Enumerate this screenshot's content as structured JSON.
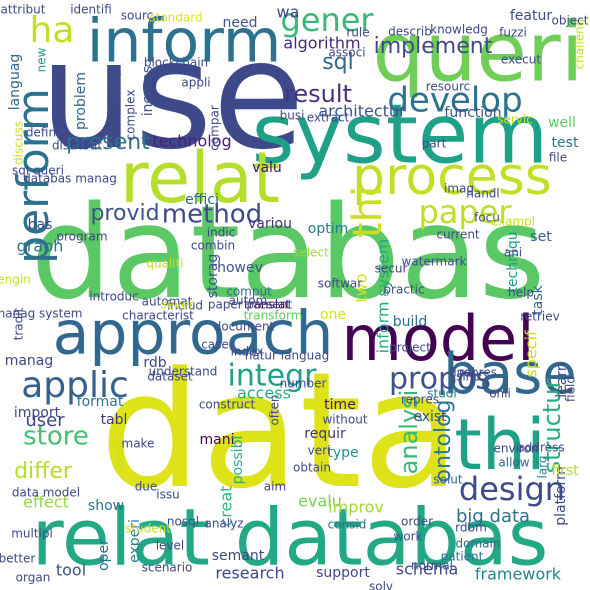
{
  "words": [
    {
      "text": "databas",
      "color": "#5ac864"
    },
    {
      "text": "data",
      "color": "#dde318"
    },
    {
      "text": "use",
      "color": "#3e4989"
    },
    {
      "text": "relat databas",
      "color": "#22a884"
    },
    {
      "text": "system",
      "color": "#1fa188"
    },
    {
      "text": "queri",
      "color": "#6ece58"
    },
    {
      "text": "inform",
      "color": "#2c728e"
    },
    {
      "text": "model",
      "color": "#440154"
    },
    {
      "text": "approach",
      "color": "#31688e"
    },
    {
      "text": "process",
      "color": "#c2df23"
    },
    {
      "text": "relat",
      "color": "#b5de2b"
    },
    {
      "text": "base",
      "color": "#31688e"
    },
    {
      "text": "thi",
      "color": "#1fa188"
    },
    {
      "text": "thi",
      "color": "#c8e020"
    },
    {
      "text": "develop",
      "color": "#2c728e"
    },
    {
      "text": "gener",
      "color": "#38b977"
    },
    {
      "text": "paper",
      "color": "#bddf26"
    },
    {
      "text": "design",
      "color": "#3e4a89"
    },
    {
      "text": "perform",
      "color": "#2c728e"
    },
    {
      "text": "ha",
      "color": "#c2df23"
    },
    {
      "text": "applic",
      "color": "#35608d"
    },
    {
      "text": "implement",
      "color": "#3f4788"
    },
    {
      "text": "propos",
      "color": "#3b528b"
    },
    {
      "text": "integr",
      "color": "#1fa188"
    },
    {
      "text": "method",
      "color": "#3e4989"
    },
    {
      "text": "store",
      "color": "#46c06f"
    },
    {
      "text": "analysi",
      "color": "#38b977"
    },
    {
      "text": "ontolog",
      "color": "#2a788e"
    },
    {
      "text": "structur",
      "color": "#27ad81"
    },
    {
      "text": "result",
      "color": "#46307e"
    },
    {
      "text": "sql",
      "color": "#31688e"
    },
    {
      "text": "differ",
      "color": "#b5de2b"
    },
    {
      "text": "provid",
      "color": "#3b528b"
    },
    {
      "text": "present",
      "color": "#2c728e"
    },
    {
      "text": "architectur",
      "color": "#3b528b"
    },
    {
      "text": "technolog",
      "color": "#482173"
    },
    {
      "text": "algorithm",
      "color": "#482878"
    },
    {
      "text": "user",
      "color": "#3e4989"
    },
    {
      "text": "big data",
      "color": "#2c728e"
    },
    {
      "text": "research",
      "color": "#3e4989"
    },
    {
      "text": "framework",
      "color": "#26828e"
    },
    {
      "text": "semant",
      "color": "#3f4788"
    },
    {
      "text": "tool",
      "color": "#3b528b"
    },
    {
      "text": "schema",
      "color": "#3f4788"
    },
    {
      "text": "support",
      "color": "#3e4989"
    },
    {
      "text": "evalu",
      "color": "#75d054"
    },
    {
      "text": "improv",
      "color": "#a0da39"
    },
    {
      "text": "type",
      "color": "#21918c"
    },
    {
      "text": "requir",
      "color": "#46327e"
    },
    {
      "text": "time",
      "color": "#48186a"
    },
    {
      "text": "exist",
      "color": "#3e4989"
    },
    {
      "text": "studi",
      "color": "#287c8e"
    },
    {
      "text": "specif",
      "color": "#c8e020"
    },
    {
      "text": "task",
      "color": "#31688e"
    },
    {
      "text": "techniqu",
      "color": "#1f9e89"
    },
    {
      "text": "set",
      "color": "#35608d"
    },
    {
      "text": "effici",
      "color": "#31688e"
    },
    {
      "text": "valu",
      "color": "#471063"
    },
    {
      "text": "variou",
      "color": "#46327e"
    },
    {
      "text": "optim",
      "color": "#2a788e"
    },
    {
      "text": "inform system",
      "color": "#22a884"
    },
    {
      "text": "two",
      "color": "#d5e21a"
    },
    {
      "text": "one",
      "color": "#d8e219"
    },
    {
      "text": "build",
      "color": "#2c728e"
    },
    {
      "text": "access",
      "color": "#27ad81"
    },
    {
      "text": "manag",
      "color": "#3e4989"
    },
    {
      "text": "rdb",
      "color": "#3e4989"
    },
    {
      "text": "import",
      "color": "#3f4788"
    },
    {
      "text": "format",
      "color": "#2a788e"
    },
    {
      "text": "tabl",
      "color": "#46337f"
    },
    {
      "text": "mani",
      "color": "#440154"
    },
    {
      "text": "possibl",
      "color": "#27ad81"
    },
    {
      "text": "creat",
      "color": "#38b977"
    },
    {
      "text": "graph",
      "color": "#2c728e"
    },
    {
      "text": "bas",
      "color": "#3f4788"
    },
    {
      "text": "program",
      "color": "#3f4788"
    },
    {
      "text": "storag",
      "color": "#3b528b"
    },
    {
      "text": "howev",
      "color": "#3b528b"
    },
    {
      "text": "comput",
      "color": "#31688e"
    },
    {
      "text": "translat",
      "color": "#440154"
    },
    {
      "text": "effect",
      "color": "#95d840"
    },
    {
      "text": "show",
      "color": "#2c728e"
    },
    {
      "text": "oper",
      "color": "#31688e"
    },
    {
      "text": "experi",
      "color": "#26828e"
    },
    {
      "text": "function",
      "color": "#3b528b"
    },
    {
      "text": "test",
      "color": "#2c728e"
    },
    {
      "text": "well",
      "color": "#5ec962"
    },
    {
      "text": "featur",
      "color": "#3e4989"
    },
    {
      "text": "execut",
      "color": "#3e4989"
    },
    {
      "text": "need",
      "color": "#3b528b"
    },
    {
      "text": "wa",
      "color": "#3f4788"
    },
    {
      "text": "map",
      "color": "#3b528b"
    },
    {
      "text": "increas",
      "color": "#3b528b"
    },
    {
      "text": "problem",
      "color": "#31688e"
    },
    {
      "text": "new",
      "color": "#1f9e89"
    },
    {
      "text": "blockchain",
      "color": "#3e4989"
    },
    {
      "text": "complex",
      "color": "#3e4989"
    },
    {
      "text": "languag",
      "color": "#31688e"
    },
    {
      "text": "learn",
      "color": "#3f4788"
    },
    {
      "text": "watermark",
      "color": "#3e4989"
    },
    {
      "text": "platform",
      "color": "#3e4989"
    },
    {
      "text": "solut",
      "color": "#31688e"
    },
    {
      "text": "environ",
      "color": "#3f4788"
    },
    {
      "text": "allow",
      "color": "#31688e"
    },
    {
      "text": "larg",
      "color": "#26828e"
    },
    {
      "text": "rdbm",
      "color": "#3f4788"
    },
    {
      "text": "aim",
      "color": "#3f4788"
    },
    {
      "text": "due",
      "color": "#3e4989"
    },
    {
      "text": "data model",
      "color": "#3e4989"
    },
    {
      "text": "multipl",
      "color": "#3e4989"
    },
    {
      "text": "organ",
      "color": "#3e4989"
    },
    {
      "text": "consid",
      "color": "#2c728e"
    },
    {
      "text": "nosql",
      "color": "#3e4989"
    },
    {
      "text": "work",
      "color": "#3b528b"
    },
    {
      "text": "domain",
      "color": "#31688e"
    },
    {
      "text": "order",
      "color": "#3e4989"
    },
    {
      "text": "patient",
      "color": "#2c728e"
    },
    {
      "text": "solv",
      "color": "#3f4788"
    },
    {
      "text": "level",
      "color": "#3e4989"
    },
    {
      "text": "first",
      "color": "#b5de2b"
    },
    {
      "text": "document",
      "color": "#3e4989"
    },
    {
      "text": "includ",
      "color": "#3e4989"
    },
    {
      "text": "softwar",
      "color": "#3e4989"
    },
    {
      "text": "practic",
      "color": "#3e4989"
    },
    {
      "text": "help",
      "color": "#3e4989"
    },
    {
      "text": "retriev",
      "color": "#3e4989"
    },
    {
      "text": "repres",
      "color": "#3e4989"
    },
    {
      "text": "onli",
      "color": "#3e4989"
    },
    {
      "text": "sinc",
      "color": "#3e4989"
    },
    {
      "text": "select",
      "color": "#a0da39"
    },
    {
      "text": "secur",
      "color": "#3e4989"
    },
    {
      "text": "file",
      "color": "#3e4989"
    },
    {
      "text": "extract",
      "color": "#3e4989"
    },
    {
      "text": "handl",
      "color": "#3e4989"
    },
    {
      "text": "resourc",
      "color": "#3e4989"
    },
    {
      "text": "sql queri",
      "color": "#3e4989"
    },
    {
      "text": "databas manag",
      "color": "#3e4989"
    },
    {
      "text": "transform",
      "color": "#5ec962"
    },
    {
      "text": "automat",
      "color": "#3e4989"
    },
    {
      "text": "manag system",
      "color": "#3e4989"
    },
    {
      "text": "introduc",
      "color": "#3e4989"
    },
    {
      "text": "dataset",
      "color": "#3e4989"
    },
    {
      "text": "construct",
      "color": "#3e4989"
    },
    {
      "text": "without",
      "color": "#3e4989"
    },
    {
      "text": "attribut",
      "color": "#3e4989"
    },
    {
      "text": "identifi",
      "color": "#3e4989"
    },
    {
      "text": "sourc",
      "color": "#3e4989"
    },
    {
      "text": "standard",
      "color": "#dde318"
    },
    {
      "text": "rule",
      "color": "#3e4989"
    },
    {
      "text": "describ",
      "color": "#3e4989"
    },
    {
      "text": "knowledg",
      "color": "#3e4989"
    },
    {
      "text": "fuzzi",
      "color": "#3e4989"
    },
    {
      "text": "associ",
      "color": "#3e4989"
    },
    {
      "text": "appli",
      "color": "#3e4989"
    },
    {
      "text": "challeng",
      "color": "#c8e020"
    },
    {
      "text": "object",
      "color": "#3e4989"
    },
    {
      "text": "busi",
      "color": "#3e4989"
    },
    {
      "text": "servic",
      "color": "#c8e020"
    },
    {
      "text": "defin",
      "color": "#3e4989"
    },
    {
      "text": "distribut",
      "color": "#3e4989"
    },
    {
      "text": "discuss",
      "color": "#c8e020"
    },
    {
      "text": "compar",
      "color": "#3e4989"
    },
    {
      "text": "part",
      "color": "#3e4989"
    },
    {
      "text": "imag",
      "color": "#3e4989"
    },
    {
      "text": "focu",
      "color": "#3e4989"
    },
    {
      "text": "exampl",
      "color": "#c8e020"
    },
    {
      "text": "current",
      "color": "#3e4989"
    },
    {
      "text": "combin",
      "color": "#3e4989"
    },
    {
      "text": "indic",
      "color": "#3e4989"
    },
    {
      "text": "qualiti",
      "color": "#c8e020"
    },
    {
      "text": "sever",
      "color": "#c8e020"
    },
    {
      "text": "tradit",
      "color": "#3e4989"
    },
    {
      "text": "engin",
      "color": "#c8e020"
    },
    {
      "text": "natur languag",
      "color": "#3e4989"
    },
    {
      "text": "paper present",
      "color": "#3e4989"
    },
    {
      "text": "characterist",
      "color": "#3e4989"
    },
    {
      "text": "autom",
      "color": "#3e4989"
    },
    {
      "text": "ani",
      "color": "#3e4989"
    },
    {
      "text": "project",
      "color": "#3e4989"
    },
    {
      "text": "index",
      "color": "#3e4989"
    },
    {
      "text": "case",
      "color": "#3e4989"
    },
    {
      "text": "final",
      "color": "#3e4989"
    },
    {
      "text": "field",
      "color": "#3e4989"
    },
    {
      "text": "understand",
      "color": "#3e4989"
    },
    {
      "text": "often",
      "color": "#3e4989"
    },
    {
      "text": "veri",
      "color": "#3e4989"
    },
    {
      "text": "obtain",
      "color": "#3e4989"
    },
    {
      "text": "number",
      "color": "#3e4989"
    },
    {
      "text": "avail",
      "color": "#c8e020"
    },
    {
      "text": "make",
      "color": "#3e4989"
    },
    {
      "text": "issu",
      "color": "#3e4989"
    },
    {
      "text": "student",
      "color": "#c8e020"
    },
    {
      "text": "analyz",
      "color": "#3e4989"
    },
    {
      "text": "address",
      "color": "#3e4989"
    },
    {
      "text": "normal",
      "color": "#3e4989"
    },
    {
      "text": "better",
      "color": "#3e4989"
    },
    {
      "text": "scenario",
      "color": "#3e4989"
    },
    {
      "text": "repres",
      "color": "#3e4989"
    }
  ]
}
